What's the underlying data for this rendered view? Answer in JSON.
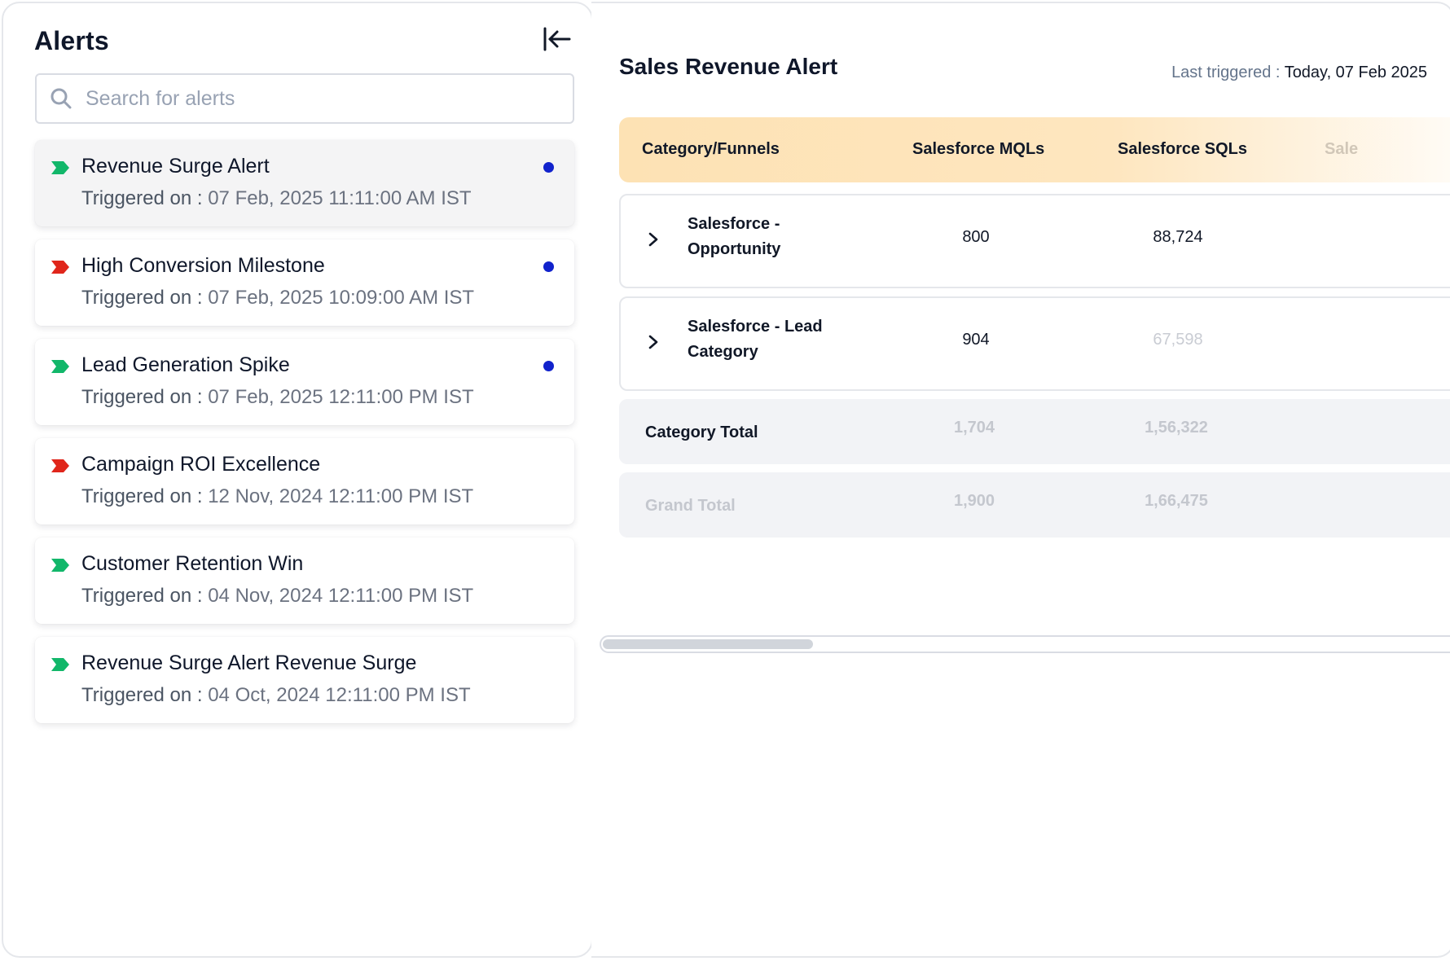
{
  "alerts_panel": {
    "title": "Alerts",
    "search_placeholder": "Search for alerts",
    "triggered_label": "Triggered on :",
    "items": [
      {
        "name": "Revenue Surge Alert",
        "triggered": "07 Feb, 2025 11:11:00 AM IST",
        "flag": "green",
        "unread": true,
        "selected": true
      },
      {
        "name": "High Conversion Milestone",
        "triggered": "07 Feb, 2025 10:09:00 AM IST",
        "flag": "red",
        "unread": true,
        "selected": false
      },
      {
        "name": "Lead Generation Spike",
        "triggered": "07 Feb, 2025 12:11:00 PM IST",
        "flag": "green",
        "unread": true,
        "selected": false
      },
      {
        "name": "Campaign ROI Excellence",
        "triggered": "12 Nov, 2024 12:11:00 PM IST",
        "flag": "red",
        "unread": false,
        "selected": false
      },
      {
        "name": "Customer Retention Win",
        "triggered": "04 Nov, 2024 12:11:00 PM IST",
        "flag": "green",
        "unread": false,
        "selected": false
      },
      {
        "name": "Revenue Surge Alert Revenue Surge",
        "triggered": "04 Oct, 2024 12:11:00 PM IST",
        "flag": "green",
        "unread": false,
        "selected": false
      }
    ]
  },
  "detail": {
    "title": "Sales Revenue Alert",
    "last_triggered_label": "Last triggered :",
    "last_triggered_value": "Today, 07 Feb 2025",
    "table": {
      "headers": [
        "Category/Funnels",
        "Salesforce MQLs",
        "Salesforce SQLs",
        "Sale"
      ],
      "rows": [
        {
          "category": "Salesforce - Opportunity",
          "mqls": "800",
          "sqls": "88,724"
        },
        {
          "category": "Salesforce - Lead Category",
          "mqls": "904",
          "sqls": "67,598"
        }
      ],
      "category_total": {
        "label": "Category Total",
        "mqls": "1,704",
        "sqls": "1,56,322"
      },
      "grand_total": {
        "label": "Grand Total",
        "mqls": "1,900",
        "sqls": "1,66,475"
      }
    }
  },
  "colors": {
    "flag_green": "#12b76a",
    "flag_red": "#e0261b",
    "unread_dot": "#1122cc",
    "header_gradient_start": "#fde2b4"
  },
  "icons": {
    "collapse": "arrow-left-to-line-icon",
    "search": "search-icon",
    "flag": "flag-icon",
    "expand": "chevron-right-icon"
  }
}
